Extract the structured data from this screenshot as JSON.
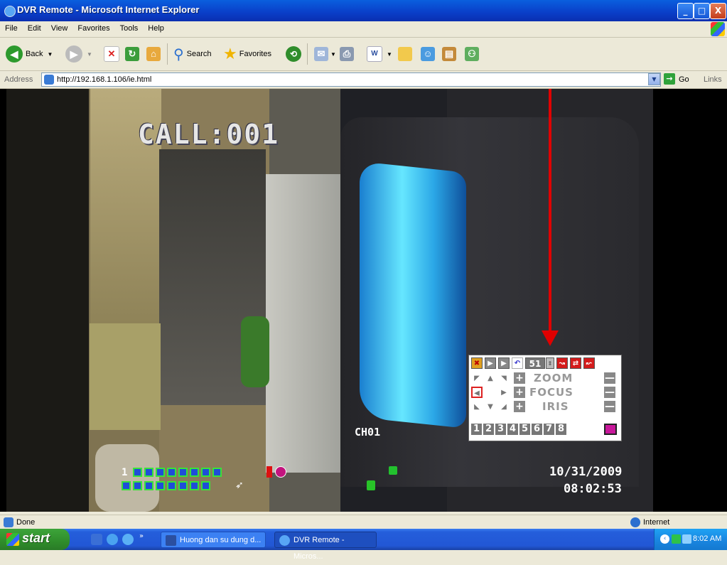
{
  "window": {
    "title": "DVR Remote - Microsoft Internet Explorer",
    "min": "_",
    "max": "□",
    "close": "X"
  },
  "menu": [
    "File",
    "Edit",
    "View",
    "Favorites",
    "Tools",
    "Help"
  ],
  "toolbar": {
    "back": "Back",
    "search": "Search",
    "favorites": "Favorites"
  },
  "address": {
    "label": "Address",
    "url": "http://192.168.1.106/ie.html",
    "go": "Go",
    "links": "Links"
  },
  "video": {
    "call_label": "CALL:001",
    "channel": "CH01",
    "date": "10/31/2009",
    "time": "08:02:53",
    "channel_row_number": "1"
  },
  "ptz": {
    "preset": "51",
    "zoom": "ZOOM",
    "focus": "FOCUS",
    "iris": "IRIS",
    "plus": "+",
    "minus": "—",
    "numbers": [
      "1",
      "2",
      "3",
      "4",
      "5",
      "6",
      "7",
      "8"
    ]
  },
  "status": {
    "text": "Done",
    "zone": "Internet"
  },
  "taskbar": {
    "start": "start",
    "tasks": [
      "Huong dan su dung d...",
      "DVR Remote - Micros..."
    ],
    "clock": "8:02 AM"
  },
  "colors": {
    "ie_titlebar": "#0A3EC8",
    "start_green": "#2f8d2b",
    "taskbar_blue": "#245edb",
    "tray_blue": "#1a88e2"
  }
}
